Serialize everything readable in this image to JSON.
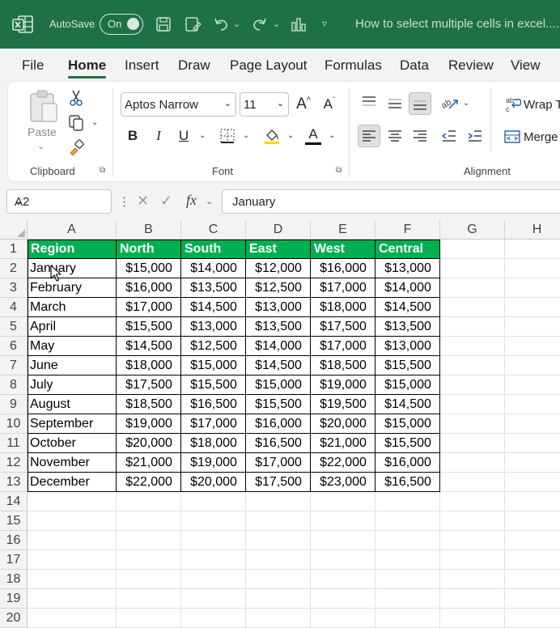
{
  "titlebar": {
    "autosave_label": "AutoSave",
    "toggle_state": "On",
    "doc_title": "How to select multiple cells in excel...."
  },
  "menu": {
    "tabs": [
      "File",
      "Home",
      "Insert",
      "Draw",
      "Page Layout",
      "Formulas",
      "Data",
      "Review",
      "View"
    ],
    "active": "Home"
  },
  "ribbon": {
    "paste_label": "Paste",
    "clipboard_label": "Clipboard",
    "font_name": "Aptos Narrow",
    "font_size": "11",
    "font_label": "Font",
    "alignment_label": "Alignment",
    "wrap_text": "Wrap T",
    "merge": "Merge"
  },
  "formula_bar": {
    "name_box": "A2",
    "fx": "fx",
    "value": "January"
  },
  "sheet": {
    "columns": [
      "A",
      "B",
      "C",
      "D",
      "E",
      "F",
      "G",
      "H"
    ],
    "rows": [
      "1",
      "2",
      "3",
      "4",
      "5",
      "6",
      "7",
      "8",
      "9",
      "10",
      "11",
      "12",
      "13",
      "14",
      "15",
      "16",
      "17",
      "18",
      "19",
      "20"
    ],
    "header": [
      "Region",
      "North",
      "South",
      "East",
      "West",
      "Central"
    ],
    "data": [
      [
        "January",
        "$15,000",
        "$14,000",
        "$12,000",
        "$16,000",
        "$13,000"
      ],
      [
        "February",
        "$16,000",
        "$13,500",
        "$12,500",
        "$17,000",
        "$14,000"
      ],
      [
        "March",
        "$17,000",
        "$14,500",
        "$13,000",
        "$18,000",
        "$14,500"
      ],
      [
        "April",
        "$15,500",
        "$13,000",
        "$13,500",
        "$17,500",
        "$13,500"
      ],
      [
        "May",
        "$14,500",
        "$12,500",
        "$14,000",
        "$17,000",
        "$13,000"
      ],
      [
        "June",
        "$18,000",
        "$15,000",
        "$14,500",
        "$18,500",
        "$15,500"
      ],
      [
        "July",
        "$17,500",
        "$15,500",
        "$15,000",
        "$19,000",
        "$15,000"
      ],
      [
        "August",
        "$18,500",
        "$16,500",
        "$15,500",
        "$19,500",
        "$14,500"
      ],
      [
        "September",
        "$19,000",
        "$17,000",
        "$16,000",
        "$20,000",
        "$15,000"
      ],
      [
        "October",
        "$20,000",
        "$18,000",
        "$16,500",
        "$21,000",
        "$15,500"
      ],
      [
        "November",
        "$21,000",
        "$19,000",
        "$17,000",
        "$22,000",
        "$16,000"
      ],
      [
        "December",
        "$22,000",
        "$20,000",
        "$17,500",
        "$23,000",
        "$16,500"
      ]
    ],
    "header_fill": "#00b050"
  },
  "colors": {
    "title_bar": "#1e7145",
    "accent": "#1e7145"
  }
}
